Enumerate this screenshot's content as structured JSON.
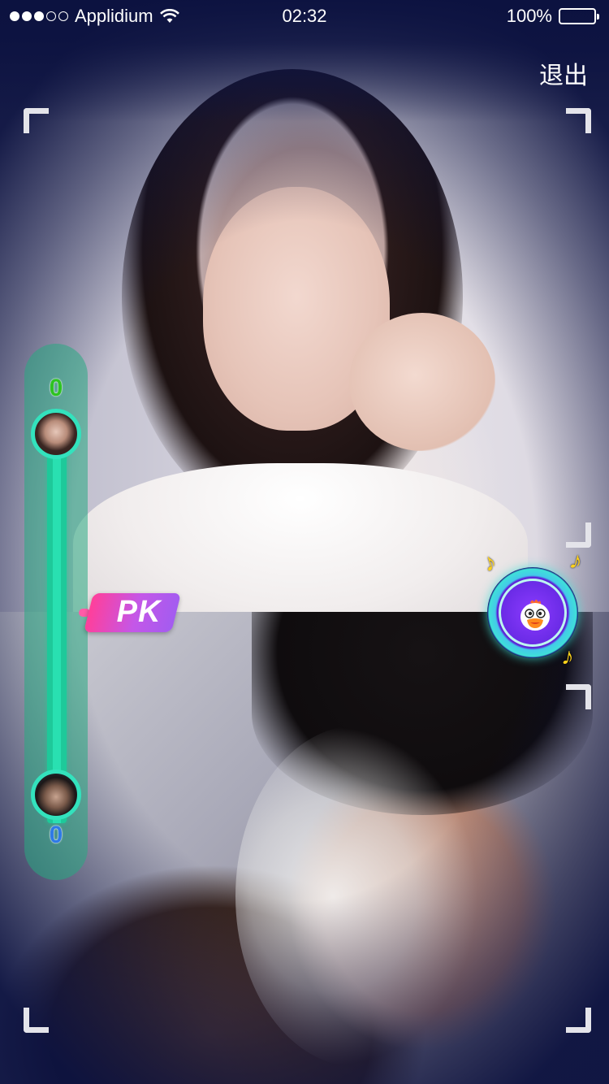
{
  "status_bar": {
    "carrier": "Applidium",
    "time": "02:32",
    "battery": "100%",
    "signal_icon": "signal-dots-icon",
    "wifi_icon": "wifi-icon",
    "battery_icon": "battery-icon"
  },
  "header": {
    "exit_label": "退出"
  },
  "score": {
    "top_score": "0",
    "bottom_score": "0",
    "top_color": "#2ec321",
    "bottom_color": "#2f7ae6",
    "track_color": "#1ec99a"
  },
  "pk_badge": {
    "label": "PK",
    "gradient_start": "#ff3f9a",
    "gradient_end": "#a35cf0"
  },
  "music_button": {
    "icon": "mascot-icon",
    "note_icon": "music-note-icon",
    "note_glyph": "♪",
    "ring_color": "#3fe0d8",
    "fill_color": "#6a2be6"
  }
}
